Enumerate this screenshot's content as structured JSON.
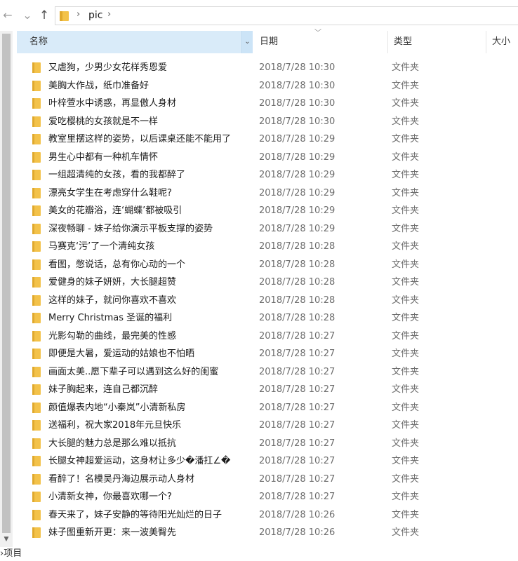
{
  "nav": {
    "back_icon": "←",
    "forward_icon": "→",
    "up_icon": "↑"
  },
  "address": {
    "path": "pic",
    "separator": "›"
  },
  "columns": {
    "name": "名称",
    "date": "日期",
    "type": "类型",
    "size": "大小"
  },
  "rows": [
    {
      "name": "又虐狗，少男少女花样秀恩爱",
      "date": "2018/7/28 10:30",
      "type": "文件夹"
    },
    {
      "name": "美胸大作战，纸巾准备好",
      "date": "2018/7/28 10:30",
      "type": "文件夹"
    },
    {
      "name": "叶梓萱水中诱惑，再显傲人身材",
      "date": "2018/7/28 10:30",
      "type": "文件夹"
    },
    {
      "name": "爱吃樱桃的女孩就是不一样",
      "date": "2018/7/28 10:30",
      "type": "文件夹"
    },
    {
      "name": "教室里摆这样的姿势，以后课桌还能不能用了",
      "date": "2018/7/28 10:29",
      "type": "文件夹"
    },
    {
      "name": "男生心中都有一种机车情怀",
      "date": "2018/7/28 10:29",
      "type": "文件夹"
    },
    {
      "name": "一组超清纯的女孩，看的我都醉了",
      "date": "2018/7/28 10:29",
      "type": "文件夹"
    },
    {
      "name": "漂亮女学生在考虑穿什么鞋呢?",
      "date": "2018/7/28 10:29",
      "type": "文件夹"
    },
    {
      "name": "美女的花瓣浴，连‘蝴蝶’都被吸引",
      "date": "2018/7/28 10:29",
      "type": "文件夹"
    },
    {
      "name": "深夜畅聊 - 妹子给你演示平板支撑的姿势",
      "date": "2018/7/28 10:29",
      "type": "文件夹"
    },
    {
      "name": "马赛克‘污’了一个清纯女孩",
      "date": "2018/7/28 10:28",
      "type": "文件夹"
    },
    {
      "name": "看图，憋说话，总有你心动的一个",
      "date": "2018/7/28 10:28",
      "type": "文件夹"
    },
    {
      "name": "爱健身的妹子妍妍，大长腿超赞",
      "date": "2018/7/28 10:28",
      "type": "文件夹"
    },
    {
      "name": "这样的妹子，就问你喜欢不喜欢",
      "date": "2018/7/28 10:28",
      "type": "文件夹"
    },
    {
      "name": "Merry Christmas 圣诞的福利",
      "date": "2018/7/28 10:28",
      "type": "文件夹"
    },
    {
      "name": "光影勾勒的曲线，最完美的性感",
      "date": "2018/7/28 10:27",
      "type": "文件夹"
    },
    {
      "name": "即便是大暑，爱运动的姑娘也不怕晒",
      "date": "2018/7/28 10:27",
      "type": "文件夹"
    },
    {
      "name": "画面太美..愿下辈子可以遇到这么好的闺蜜",
      "date": "2018/7/28 10:27",
      "type": "文件夹"
    },
    {
      "name": "妹子胸起来，连自己都沉醉",
      "date": "2018/7/28 10:27",
      "type": "文件夹"
    },
    {
      "name": "颜值爆表内地“小秦岚”小清新私房",
      "date": "2018/7/28 10:27",
      "type": "文件夹"
    },
    {
      "name": "送福利，祝大家2018年元旦快乐",
      "date": "2018/7/28 10:27",
      "type": "文件夹"
    },
    {
      "name": "大长腿的魅力总是那么难以抵抗",
      "date": "2018/7/28 10:27",
      "type": "文件夹"
    },
    {
      "name": "长腿女神超爱运动，这身材让多少�潘扛∠�",
      "date": "2018/7/28 10:27",
      "type": "文件夹"
    },
    {
      "name": "看醉了！名模吴丹海边展示动人身材",
      "date": "2018/7/28 10:27",
      "type": "文件夹"
    },
    {
      "name": "小清新女神，你最喜欢哪一个?",
      "date": "2018/7/28 10:27",
      "type": "文件夹"
    },
    {
      "name": "春天来了，妹子安静的等待阳光灿烂的日子",
      "date": "2018/7/28 10:26",
      "type": "文件夹"
    },
    {
      "name": "妹子图重新开更：来一波美臀先",
      "date": "2018/7/28 10:26",
      "type": "文件夹"
    }
  ],
  "status": {
    "items_label": "›项目"
  },
  "colors": {
    "folder": "#f3c24a",
    "header_selected": "#d9ebf9"
  }
}
